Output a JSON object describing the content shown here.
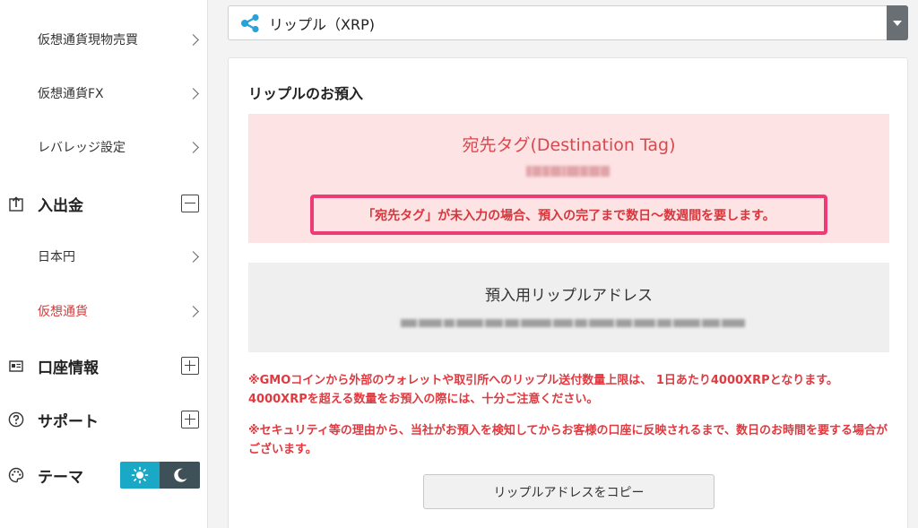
{
  "sidebar": {
    "items": [
      {
        "label": "仮想通貨現物売買"
      },
      {
        "label": "仮想通貨FX"
      },
      {
        "label": "レバレッジ設定"
      }
    ],
    "sections": [
      {
        "label": "入出金",
        "icon": "deposit-withdraw-icon",
        "state": "expanded",
        "items": [
          {
            "label": "日本円"
          },
          {
            "label": "仮想通貨"
          }
        ]
      },
      {
        "label": "口座情報",
        "icon": "account-card-icon",
        "state": "collapsed"
      },
      {
        "label": "サポート",
        "icon": "help-icon",
        "state": "collapsed"
      },
      {
        "label": "テーマ",
        "icon": "palette-icon"
      }
    ],
    "active_color": "#d23c3c"
  },
  "theme_switch": {
    "options": [
      "sun-icon",
      "moon-icon"
    ],
    "selected": "sun-icon",
    "accent": "#1aa8c7"
  },
  "currency_select": {
    "value": "リップル（XRP)",
    "icon": "xrp-icon"
  },
  "card": {
    "title": "リップルのお預入",
    "destination": {
      "title": "宛先タグ(Destination Tag)",
      "warning": "「宛先タグ」が未入力の場合、預入の完了まで数日〜数週間を要します。"
    },
    "address": {
      "title": "預入用リップルアドレス"
    },
    "notices": [
      "※GMOコインから外部のウォレットや取引所へのリップル送付数量上限は、 1日あたり4000XRPとなります。4000XRPを超える数量をお預入の際には、十分ご注意ください。",
      "※セキュリティ等の理由から、当社がお預入を検知してからお客様の口座に反映されるまで、数日のお時間を要する場合がございます。"
    ],
    "copy_button": "リップルアドレスをコピー"
  },
  "colors": {
    "warning_red": "#d8363c",
    "warning_border": "#ee3a76",
    "dest_bg": "#fde3e4"
  }
}
